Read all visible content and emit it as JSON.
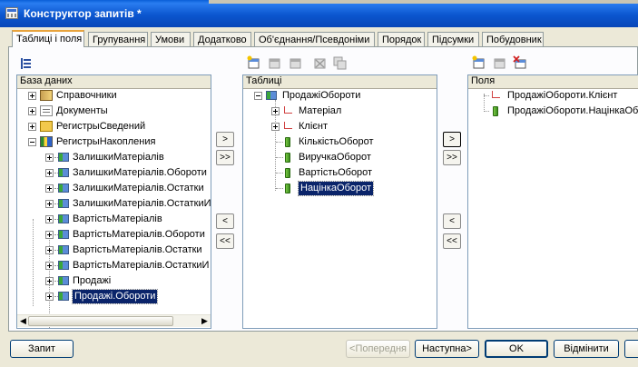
{
  "window": {
    "title": "Конструктор запитів *"
  },
  "tabs": [
    {
      "label": "Таблиці і поля",
      "active": true
    },
    {
      "label": "Групування"
    },
    {
      "label": "Умови"
    },
    {
      "label": "Додатково"
    },
    {
      "label": "Об'єднання/Псевдоніми"
    },
    {
      "label": "Порядок"
    },
    {
      "label": "Підсумки"
    },
    {
      "label": "Побудовник"
    }
  ],
  "database": {
    "header": "База даних",
    "items": [
      {
        "label": "Справочники",
        "icon": "catalog-icon"
      },
      {
        "label": "Документы",
        "icon": "document-icon"
      },
      {
        "label": "РегистрыСведений",
        "icon": "info-register-icon"
      },
      {
        "label": "РегистрыНакопления",
        "icon": "accumulation-register-icon"
      },
      {
        "label": "ЗалишкиМатеріалів"
      },
      {
        "label": "ЗалишкиМатеріалів.Обороти"
      },
      {
        "label": "ЗалишкиМатеріалів.Остатки"
      },
      {
        "label": "ЗалишкиМатеріалів.ОстаткиИ"
      },
      {
        "label": "ВартістьМатеріалів"
      },
      {
        "label": "ВартістьМатеріалів.Обороти"
      },
      {
        "label": "ВартістьМатеріалів.Остатки"
      },
      {
        "label": "ВартістьМатеріалів.ОстаткиИ"
      },
      {
        "label": "Продажі"
      },
      {
        "label": "Продажі.Обороти",
        "selected": true
      }
    ]
  },
  "tables": {
    "header": "Таблиці",
    "root": "ПродажіОбороти",
    "items": [
      {
        "label": "Матеріал",
        "type": "dimension"
      },
      {
        "label": "Клієнт",
        "type": "dimension"
      },
      {
        "label": "КількістьОборот",
        "type": "resource"
      },
      {
        "label": "ВиручкаОборот",
        "type": "resource"
      },
      {
        "label": "ВартістьОборот",
        "type": "resource"
      },
      {
        "label": "НацінкаОборот",
        "type": "resource",
        "selected": true
      }
    ]
  },
  "fields": {
    "header": "Поля",
    "items": [
      {
        "label": "ПродажіОбороти.Клієнт"
      },
      {
        "label": "ПродажіОбороти.НацінкаОборот"
      }
    ]
  },
  "move_buttons": {
    "add": ">",
    "add_all": ">>",
    "remove": "<",
    "remove_all": "<<"
  },
  "footer": {
    "query": "Запит",
    "prev": "<Попередня",
    "next": "Наступна>",
    "ok": "OK",
    "cancel": "Відмінити"
  }
}
